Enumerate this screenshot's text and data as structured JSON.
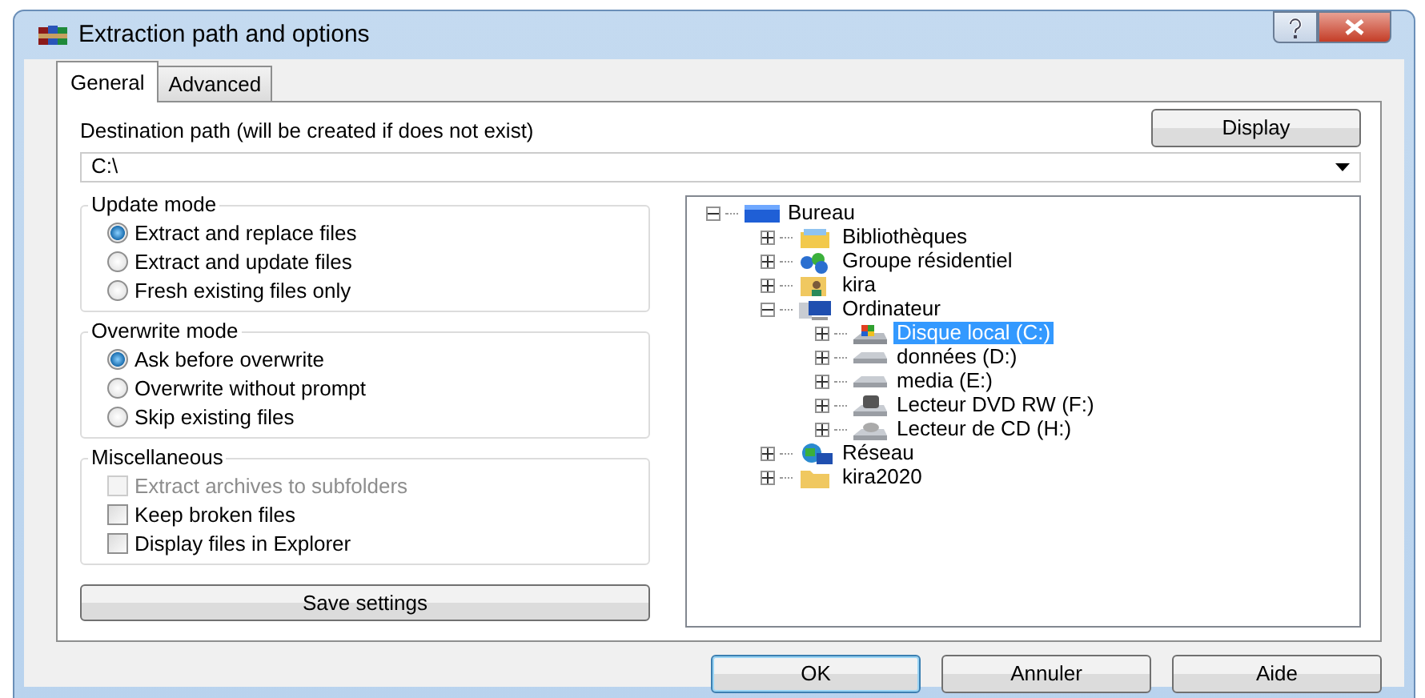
{
  "window": {
    "title": "Extraction path and options"
  },
  "tabs": [
    {
      "label": "General",
      "selected": true
    },
    {
      "label": "Advanced",
      "selected": false
    }
  ],
  "destination": {
    "label": "Destination path (will be created if does not exist)",
    "value": "C:\\",
    "display_button": "Display"
  },
  "update_mode": {
    "title": "Update mode",
    "options": [
      {
        "label": "Extract and replace files",
        "selected": true
      },
      {
        "label": "Extract and update files",
        "selected": false
      },
      {
        "label": "Fresh existing files only",
        "selected": false
      }
    ]
  },
  "overwrite_mode": {
    "title": "Overwrite mode",
    "options": [
      {
        "label": "Ask before overwrite",
        "selected": true
      },
      {
        "label": "Overwrite without prompt",
        "selected": false
      },
      {
        "label": "Skip existing files",
        "selected": false
      }
    ]
  },
  "miscellaneous": {
    "title": "Miscellaneous",
    "options": [
      {
        "label": "Extract archives to subfolders",
        "checked": false,
        "disabled": true
      },
      {
        "label": "Keep broken files",
        "checked": false,
        "disabled": false
      },
      {
        "label": "Display files in Explorer",
        "checked": false,
        "disabled": false
      }
    ]
  },
  "save_button": "Save settings",
  "tree": [
    {
      "label": "Bureau",
      "kind": "desktop",
      "expanded": true,
      "selected": false,
      "children": [
        {
          "label": "Bibliothèques",
          "kind": "library",
          "expanded": false,
          "selected": false
        },
        {
          "label": "Groupe résidentiel",
          "kind": "homegroup",
          "expanded": false,
          "selected": false
        },
        {
          "label": "kira",
          "kind": "userfolder",
          "expanded": false,
          "selected": false
        },
        {
          "label": "Ordinateur",
          "kind": "computer",
          "expanded": true,
          "selected": false,
          "children": [
            {
              "label": "Disque local (C:)",
              "kind": "systemdrive",
              "expanded": false,
              "selected": true
            },
            {
              "label": "données (D:)",
              "kind": "drive",
              "expanded": false,
              "selected": false
            },
            {
              "label": "media (E:)",
              "kind": "drive",
              "expanded": false,
              "selected": false
            },
            {
              "label": "Lecteur DVD RW (F:)",
              "kind": "dvd",
              "expanded": false,
              "selected": false
            },
            {
              "label": "Lecteur de CD (H:)",
              "kind": "cd",
              "expanded": false,
              "selected": false
            }
          ]
        },
        {
          "label": "Réseau",
          "kind": "network",
          "expanded": false,
          "selected": false
        },
        {
          "label": "kira2020",
          "kind": "folder",
          "expanded": false,
          "selected": false
        }
      ]
    }
  ],
  "buttons": [
    {
      "label": "OK",
      "default": true
    },
    {
      "label": "Annuler",
      "default": false
    },
    {
      "label": "Aide",
      "default": false
    }
  ]
}
